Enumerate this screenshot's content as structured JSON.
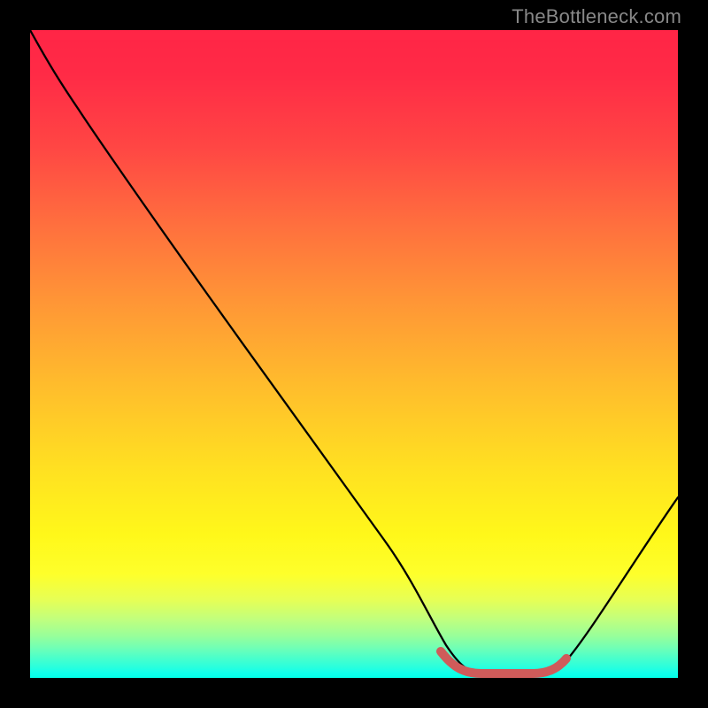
{
  "watermark": "TheBottleneck.com",
  "chart_data": {
    "type": "line",
    "title": "",
    "xlabel": "",
    "ylabel": "",
    "xlim": [
      0,
      100
    ],
    "ylim": [
      0,
      100
    ],
    "grid": false,
    "background_gradient": [
      {
        "stop": 0,
        "color": "#ff2546"
      },
      {
        "stop": 50,
        "color": "#ffb02f"
      },
      {
        "stop": 80,
        "color": "#feff2b"
      },
      {
        "stop": 100,
        "color": "#02ffe9"
      }
    ],
    "series": [
      {
        "name": "curve",
        "color": "#000000",
        "x": [
          0,
          4,
          8,
          15,
          25,
          38,
          52,
          60,
          64,
          68,
          72,
          77,
          82,
          88,
          94,
          100
        ],
        "y": [
          100,
          93,
          88,
          78,
          64,
          45,
          25,
          13,
          5,
          1,
          0,
          0,
          1,
          10,
          24,
          40
        ]
      }
    ],
    "highlight": {
      "name": "optimal-range",
      "color": "#cf5b5a",
      "x_range": [
        63,
        82
      ],
      "y_at_range": 0
    }
  }
}
